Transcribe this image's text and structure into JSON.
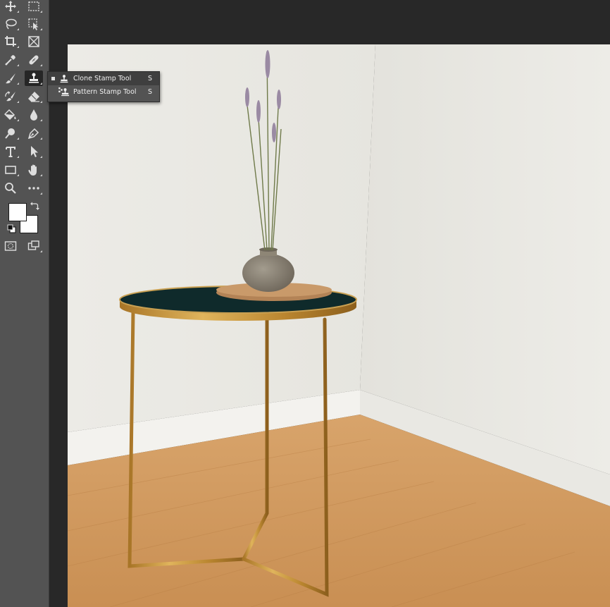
{
  "app": {
    "accent": "#535353"
  },
  "toolbar": {
    "tools": [
      {
        "name": "move-tool",
        "icon": "move-icon"
      },
      {
        "name": "marquee-tool",
        "icon": "rect-marquee-icon"
      },
      {
        "name": "lasso-tool",
        "icon": "lasso-icon"
      },
      {
        "name": "object-selection-tool",
        "icon": "object-selection-icon"
      },
      {
        "name": "crop-tool",
        "icon": "crop-icon"
      },
      {
        "name": "frame-tool",
        "icon": "frame-icon"
      },
      {
        "name": "eyedropper-tool",
        "icon": "eyedropper-icon"
      },
      {
        "name": "healing-brush-tool",
        "icon": "bandage-icon"
      },
      {
        "name": "brush-tool",
        "icon": "brush-icon"
      },
      {
        "name": "clone-stamp-tool",
        "icon": "stamp-icon",
        "active": true
      },
      {
        "name": "history-brush-tool",
        "icon": "history-brush-icon"
      },
      {
        "name": "eraser-tool",
        "icon": "eraser-icon"
      },
      {
        "name": "paint-bucket-tool",
        "icon": "paint-bucket-icon"
      },
      {
        "name": "blur-tool",
        "icon": "blur-drop-icon"
      },
      {
        "name": "dodge-tool",
        "icon": "dodge-icon"
      },
      {
        "name": "pen-tool",
        "icon": "pen-icon"
      },
      {
        "name": "type-tool",
        "icon": "type-icon"
      },
      {
        "name": "path-selection-tool",
        "icon": "arrow-icon"
      },
      {
        "name": "rectangle-tool",
        "icon": "rectangle-icon"
      },
      {
        "name": "hand-tool",
        "icon": "hand-icon"
      },
      {
        "name": "zoom-tool",
        "icon": "zoom-icon"
      },
      {
        "name": "more-tools",
        "icon": "ellipsis-icon"
      }
    ],
    "foreground_color": "#ffffff",
    "background_color": "#ffffff"
  },
  "flyout": {
    "items": [
      {
        "label": "Clone Stamp Tool",
        "shortcut": "S",
        "icon": "stamp-icon",
        "selected": true
      },
      {
        "label": "Pattern Stamp Tool",
        "shortcut": "S",
        "icon": "pattern-stamp-icon",
        "selected": false
      }
    ]
  },
  "canvas": {
    "image": "photo-side-table-with-vase",
    "wall_color": "#e9e8e2",
    "floor_color": "#c8945a",
    "metal_color": "#c4923a"
  }
}
